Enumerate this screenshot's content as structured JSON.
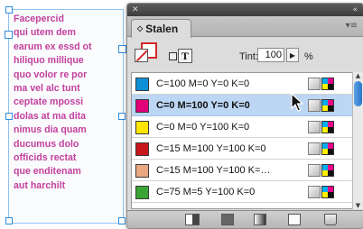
{
  "text_frame": {
    "lines": [
      "Facepercid",
      "qui utem dem",
      "earum ex essd ot",
      "hiliquo millique",
      "quo volor re por",
      "ma vel alc tunt",
      "ceptate mpossi",
      "dolas at ma dita",
      "nimus dia quam",
      "ducumus dolo",
      "officids rectat",
      "que enditenam",
      "aut harchilt"
    ],
    "text_color": "#c2409d"
  },
  "panel": {
    "title_close_icon": "close-icon",
    "collapse_glyph": "«",
    "tab_label": "Stalen",
    "tab_dot": "◇",
    "menu_glyph": "▾≡",
    "tint_label": "Tint:",
    "tint_value": "100",
    "tint_arrow": "▶",
    "tint_unit": "%",
    "t_glyph": "T",
    "swatches": [
      {
        "name": "C=100 M=0 Y=0 K=0",
        "color": "#0f8fd6",
        "selected": false
      },
      {
        "name": "C=0 M=100 Y=0 K=0",
        "color": "#e2007a",
        "selected": true
      },
      {
        "name": "C=0 M=0 Y=100 K=0",
        "color": "#ffe600",
        "selected": false
      },
      {
        "name": "C=15 M=100 Y=100 K=0",
        "color": "#c8161d",
        "selected": false
      },
      {
        "name": "C=15 M=100 Y=100 K=…",
        "color": "#eaa882",
        "selected": false
      },
      {
        "name": "C=75 M=5 Y=100 K=0",
        "color": "#3aa535",
        "selected": false
      }
    ],
    "scroll_up": "▲",
    "scroll_down": "▼"
  },
  "colors": {
    "selection": "#bcd6f4",
    "frame_border": "#8ec3ee",
    "stroke_red": "#d02a2a"
  }
}
